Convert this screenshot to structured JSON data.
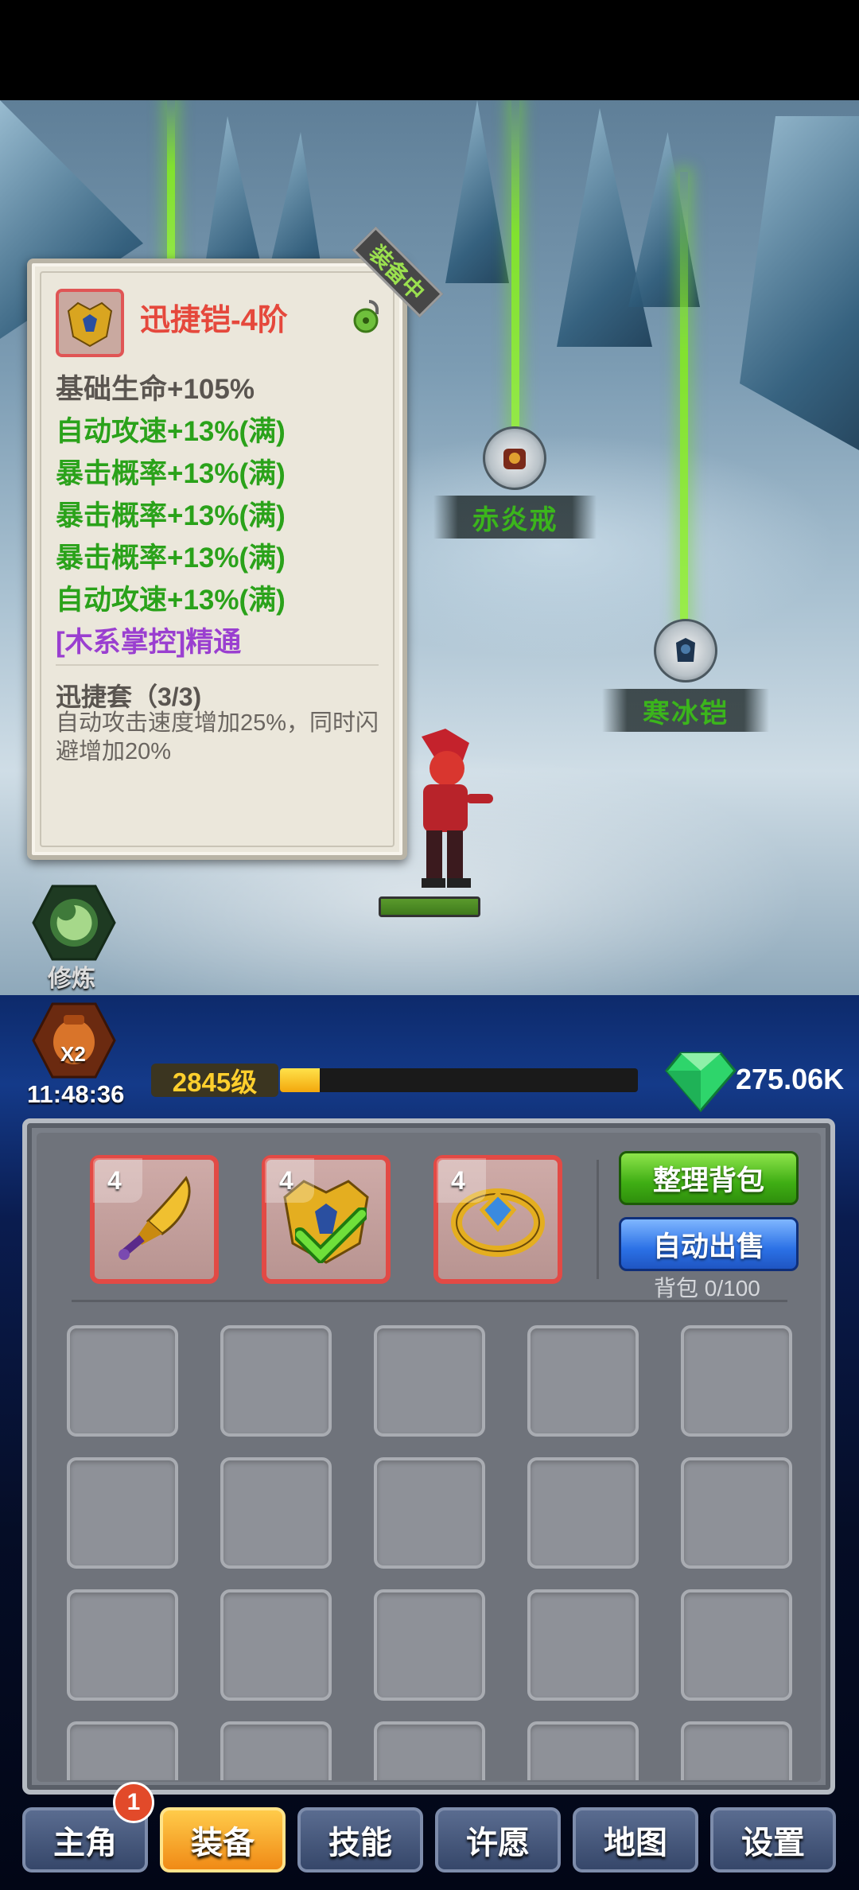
{
  "scene": {
    "drops": [
      {
        "name": "赤炎戒"
      },
      {
        "name": "寒冰铠"
      }
    ]
  },
  "tooltip": {
    "item_name": "迅捷铠-4阶",
    "equipped_ribbon": "装备中",
    "base_stat": "基础生命+105%",
    "bonus_stats": [
      "自动攻速+13%(满)",
      "暴击概率+13%(满)",
      "暴击概率+13%(满)",
      "暴击概率+13%(满)",
      "自动攻速+13%(满)"
    ],
    "mastery": "[木系掌控]精通",
    "set_title": "迅捷套（3/3)",
    "set_desc": "自动攻击速度增加25%，同时闪避增加20%"
  },
  "side": {
    "cultivate_label": "修炼",
    "boost_badge": "X2",
    "boost_timer": "11:48:36"
  },
  "hud": {
    "level": "2845级",
    "xp_fraction": 0.11,
    "gems": "275.06K"
  },
  "bag": {
    "equipped": [
      {
        "level": "4",
        "type": "sword"
      },
      {
        "level": "4",
        "type": "armor"
      },
      {
        "level": "4",
        "type": "ring"
      }
    ],
    "sort_button": "整理背包",
    "auto_sell_button": "自动出售",
    "capacity": "背包 0/100"
  },
  "nav": {
    "tabs": [
      "主角",
      "装备",
      "技能",
      "许愿",
      "地图",
      "设置"
    ],
    "active": 1,
    "badge": "1"
  },
  "colors": {
    "rare_red": "#e24a45",
    "stat_green": "#2aa21a",
    "mastery_purple": "#9a3fd0",
    "title_red": "#e5483c"
  }
}
